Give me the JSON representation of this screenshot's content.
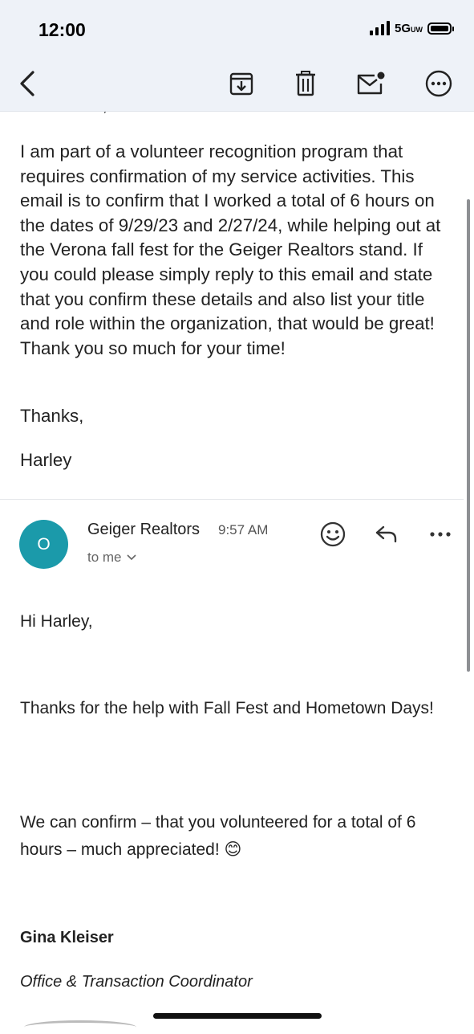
{
  "status_bar": {
    "time": "12:00",
    "network": "5G",
    "network_suffix": "UW"
  },
  "toolbar": {
    "back": "back-icon",
    "archive": "archive-icon",
    "delete": "trash-icon",
    "mark_unread": "mail-unread-icon",
    "more": "more-icon"
  },
  "first_message": {
    "greeting_clipped": "Hello Gina,",
    "body": "I am part of a volunteer recognition program that requires confirmation of my service activities. This email is to confirm that I worked a total of 6 hours on the dates of 9/29/23 and 2/27/24, while helping out at the Verona fall fest for the Geiger Realtors stand. If you could please simply reply to this email and state that you confirm these details and also list your title and role within the organization, that would be great! Thank you so much for your time!",
    "closing": "Thanks,",
    "signature": "Harley"
  },
  "second_message": {
    "avatar_letter": "O",
    "sender": "Geiger Realtors",
    "time": "9:57 AM",
    "recipient": "to me",
    "greeting": "Hi Harley,",
    "para1": "Thanks for the help with Fall Fest and Hometown Days!",
    "para2": "We can confirm – that you volunteered for a total of 6 hours – much appreciated! 😊",
    "sig_name": "Gina Kleiser",
    "sig_title": "Office & Transaction Coordinator"
  },
  "colors": {
    "avatar": "#1b9aaa",
    "topbar": "#eef2f8"
  }
}
